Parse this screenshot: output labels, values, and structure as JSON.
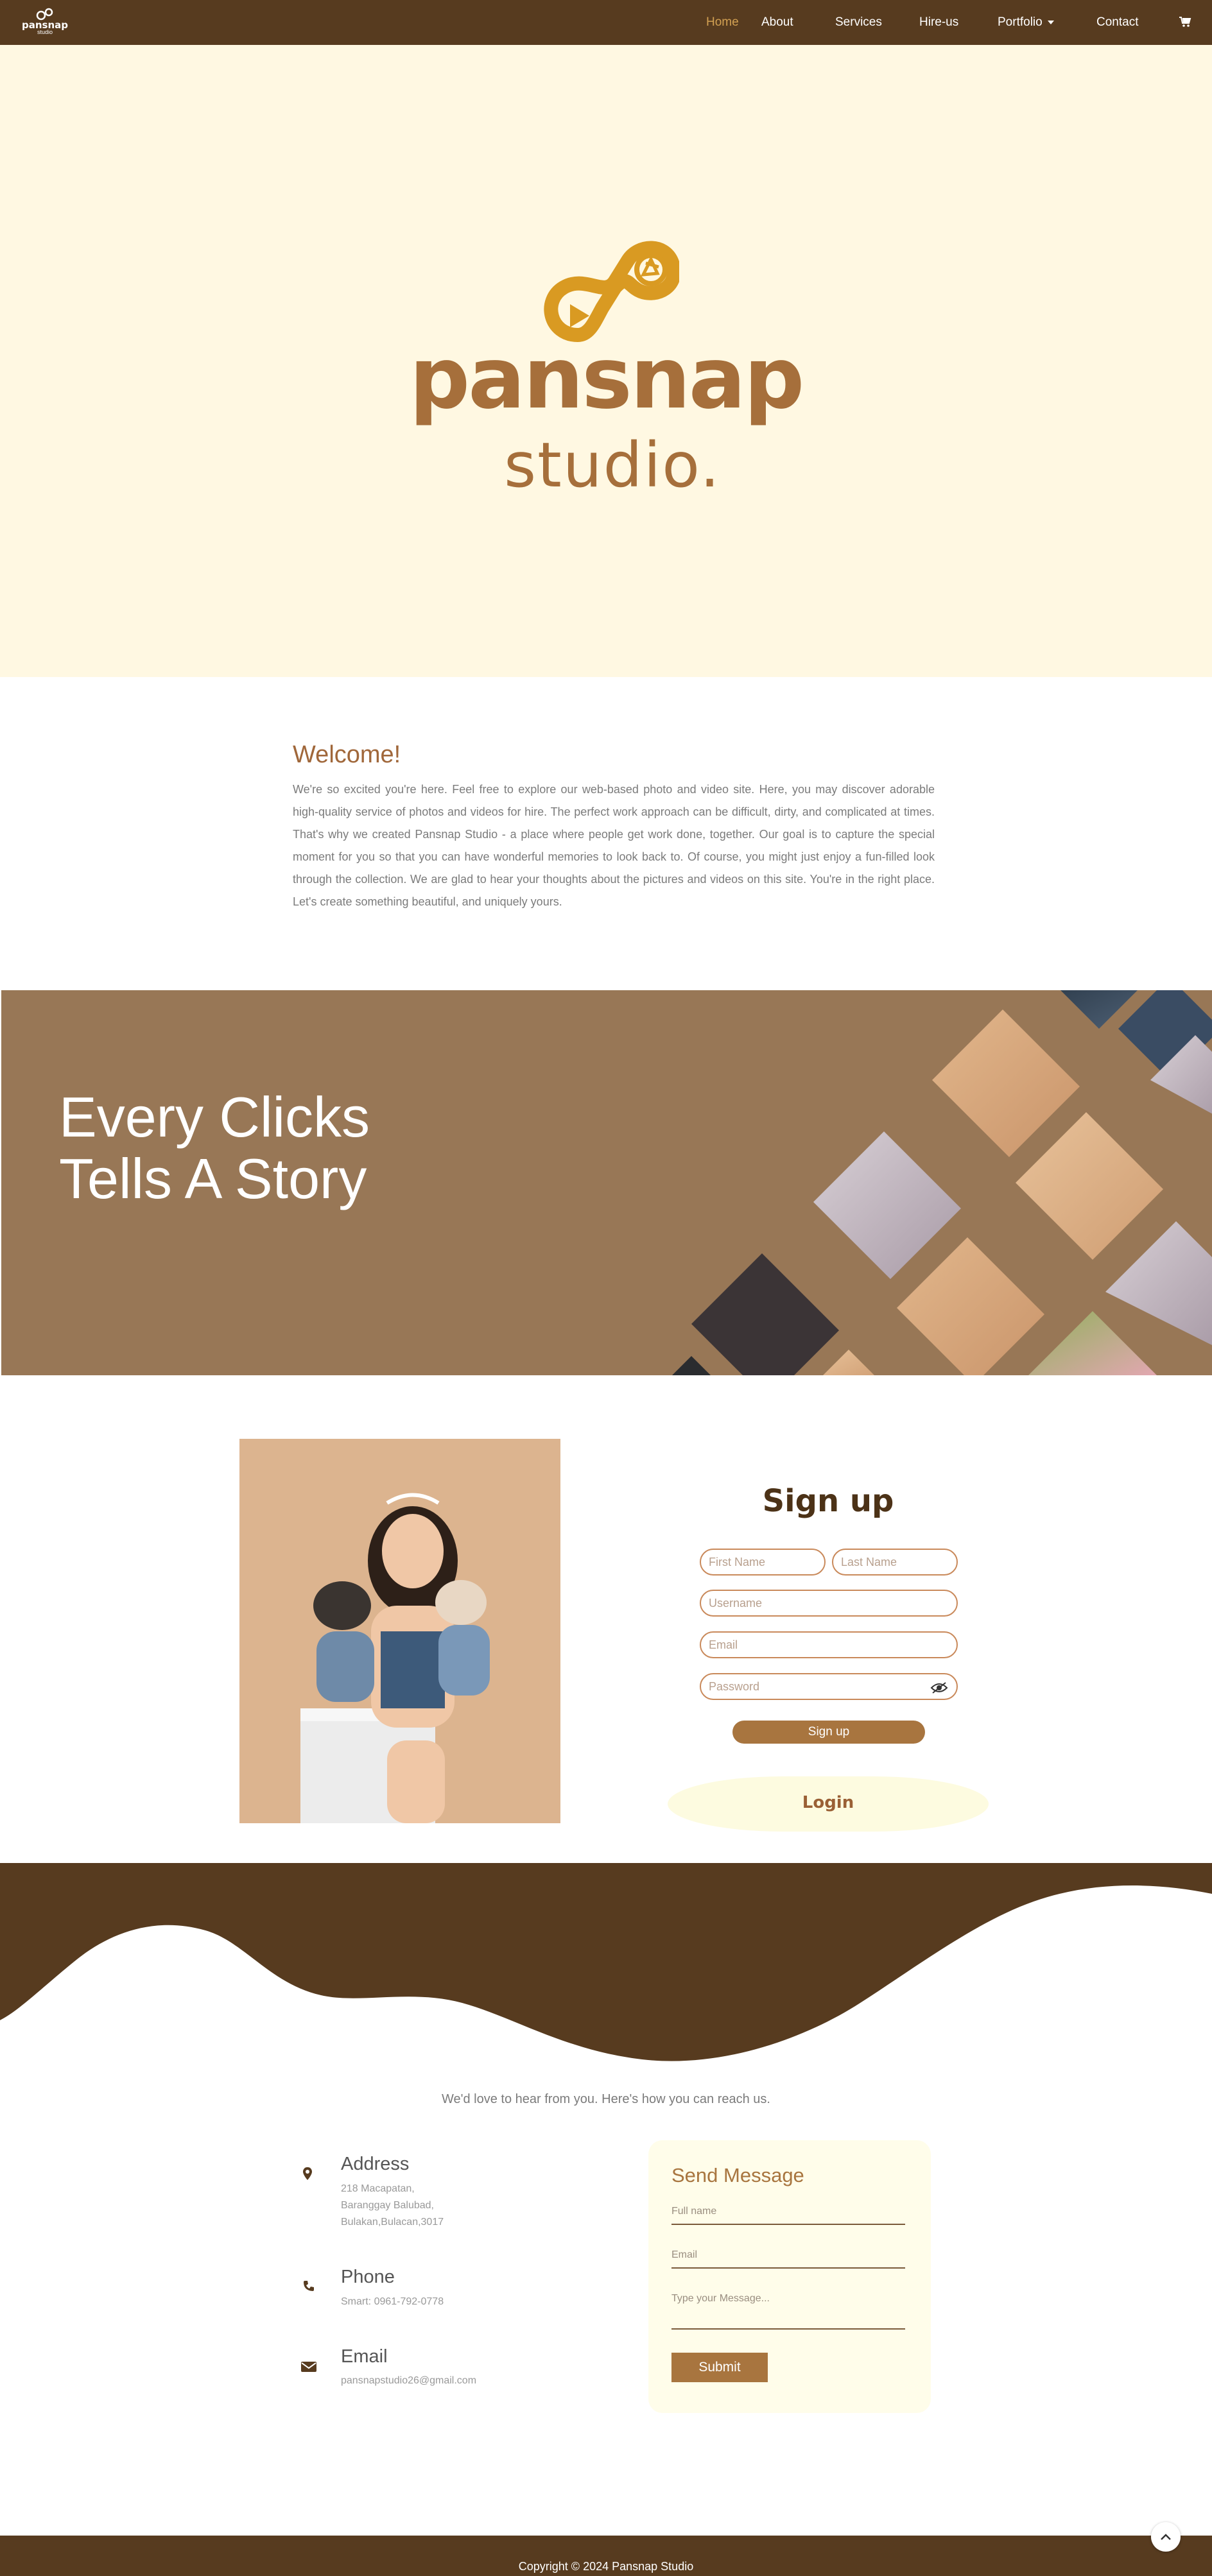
{
  "nav": {
    "logo_line1": "pansnap",
    "logo_line2": "studio",
    "items": [
      {
        "label": "Home",
        "active": true
      },
      {
        "label": "About"
      },
      {
        "label": "Services"
      },
      {
        "label": "Hire-us"
      },
      {
        "label": "Portfolio"
      },
      {
        "label": "Contact"
      }
    ],
    "cart_icon": "cart-icon"
  },
  "hero": {
    "brand_line1": "pansnap",
    "brand_line2": "studio."
  },
  "welcome": {
    "title": "Welcome!",
    "text": "We're so excited you're here. Feel free to explore our web-based photo and video site. Here, you may discover adorable high-quality service of photos and videos for hire. The perfect work approach can be difficult, dirty, and complicated at times. That's why we created Pansnap Studio - a place where people get work done, together. Our goal is to capture the special moment for you so that you can have wonderful memories to look back to. Of course, you might just enjoy a fun-filled look through the collection. We are glad to hear your thoughts about the pictures and videos on this site. You're in the right place. Let's create something beautiful, and uniquely yours."
  },
  "banner": {
    "line1": "Every Clicks",
    "line2": "Tells A Story"
  },
  "signup": {
    "title": "Sign up",
    "first_name_placeholder": "First Name",
    "last_name_placeholder": "Last Name",
    "username_placeholder": "Username",
    "email_placeholder": "Email",
    "password_placeholder": "Password",
    "submit_label": "Sign up",
    "login_label": "Login"
  },
  "contact": {
    "intro": "We'd love to hear from you. Here's how you can reach us.",
    "address_title": "Address",
    "address_lines": [
      "218 Macapatan,",
      "Baranggay Balubad,",
      "Bulakan,Bulacan,3017"
    ],
    "phone_title": "Phone",
    "phone_value": "Smart: 0961-792-0778",
    "email_title": "Email",
    "email_value": "pansnapstudio26@gmail.com",
    "form_title": "Send Message",
    "fullname_placeholder": "Full name",
    "email_placeholder": "Email",
    "message_placeholder": "Type your Message...",
    "submit_label": "Submit"
  },
  "footer": {
    "copyright": "Copyright © 2024 Pansnap Studio"
  },
  "colors": {
    "nav_bg": "#573b1f",
    "hero_bg": "#fff8e2",
    "brand": "#a66f3b",
    "logo_gold": "#d99a22",
    "banner_bg": "#987756",
    "accent_button": "#a8753f"
  }
}
